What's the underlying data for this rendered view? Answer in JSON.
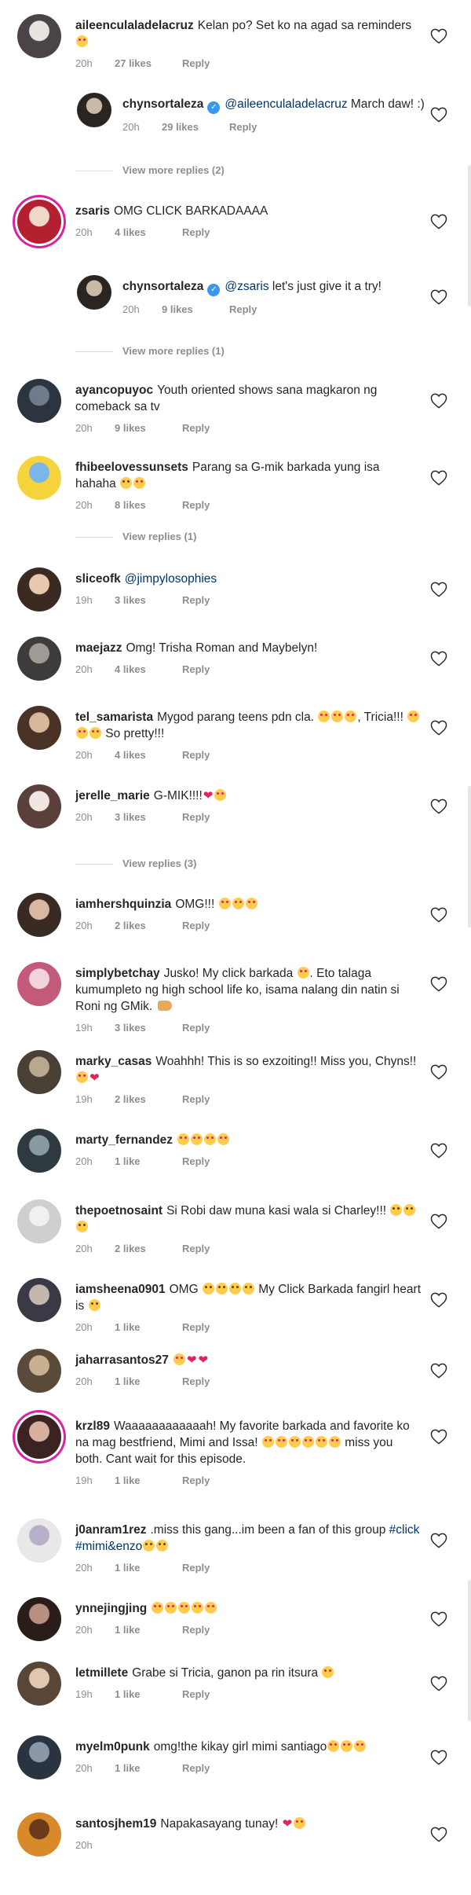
{
  "comments": [
    {
      "username": "aileenculaladelacruz",
      "segments": [
        {
          "t": "text",
          "v": "Kelan po? Set ko na agad sa reminders "
        },
        {
          "t": "emoji",
          "v": "heart-eyes"
        }
      ],
      "time": "20h",
      "likes": "27 likes",
      "reply_label": "Reply",
      "avatar_colors": [
        "#4a4448",
        "#e8e2e0"
      ],
      "ring": false
    },
    {
      "username": "chynsortaleza",
      "verified": true,
      "reply": true,
      "segments": [
        {
          "t": "mention",
          "v": "@aileenculaladelacruz"
        },
        {
          "t": "text",
          "v": " March daw! :)"
        }
      ],
      "time": "20h",
      "likes": "29 likes",
      "reply_label": "Reply",
      "avatar_colors": [
        "#2b2521",
        "#c9b9a6"
      ],
      "ring": false
    },
    {
      "view_replies": "View more replies (2)"
    },
    {
      "username": "zsaris",
      "segments": [
        {
          "t": "text",
          "v": "OMG CLICK BARKADAAAA"
        }
      ],
      "time": "20h",
      "likes": "4 likes",
      "reply_label": "Reply",
      "avatar_colors": [
        "#b3202f",
        "#f0d8c8"
      ],
      "ring": true
    },
    {
      "username": "chynsortaleza",
      "verified": true,
      "reply": true,
      "segments": [
        {
          "t": "mention",
          "v": "@zsaris"
        },
        {
          "t": "text",
          "v": " let's just give it a try!"
        }
      ],
      "time": "20h",
      "likes": "9 likes",
      "reply_label": "Reply",
      "avatar_colors": [
        "#2b2521",
        "#c9b9a6"
      ],
      "ring": false
    },
    {
      "view_replies": "View more replies (1)"
    },
    {
      "username": "ayancopuyoc",
      "segments": [
        {
          "t": "text",
          "v": "Youth oriented shows sana magkaron ng comeback sa tv"
        }
      ],
      "time": "20h",
      "likes": "9 likes",
      "reply_label": "Reply",
      "avatar_colors": [
        "#2c3440",
        "#6f7a8a"
      ],
      "ring": false
    },
    {
      "username": "fhibeelovessunsets",
      "segments": [
        {
          "t": "text",
          "v": "Parang sa G-mik barkada yung isa hahaha "
        },
        {
          "t": "emoji",
          "v": "blush"
        },
        {
          "t": "emoji",
          "v": "heart-eyes"
        }
      ],
      "time": "20h",
      "likes": "8 likes",
      "reply_label": "Reply",
      "avatar_colors": [
        "#f5d33a",
        "#7ab6e8"
      ],
      "ring": false
    },
    {
      "view_replies": "View replies (1)"
    },
    {
      "username": "sliceofk",
      "segments": [
        {
          "t": "mention",
          "v": "@jimpylosophies"
        }
      ],
      "time": "19h",
      "likes": "3 likes",
      "reply_label": "Reply",
      "avatar_colors": [
        "#3b2a22",
        "#e8c9b0"
      ],
      "ring": false
    },
    {
      "username": "maejazz",
      "segments": [
        {
          "t": "text",
          "v": "Omg! Trisha Roman and Maybelyn!"
        }
      ],
      "time": "20h",
      "likes": "4 likes",
      "reply_label": "Reply",
      "avatar_colors": [
        "#3c3c3c",
        "#a09a96"
      ],
      "ring": false
    },
    {
      "username": "tel_samarista",
      "segments": [
        {
          "t": "text",
          "v": "Mygod parang teens pdn cla. "
        },
        {
          "t": "emoji",
          "v": "heart-eyes"
        },
        {
          "t": "emoji",
          "v": "heart-eyes"
        },
        {
          "t": "emoji",
          "v": "heart-eyes"
        },
        {
          "t": "text",
          "v": ", Tricia!!! "
        },
        {
          "t": "emoji",
          "v": "heart-eyes"
        },
        {
          "t": "emoji",
          "v": "heart-eyes"
        },
        {
          "t": "emoji",
          "v": "heart-eyes"
        },
        {
          "t": "text",
          "v": " So pretty!!!"
        }
      ],
      "time": "20h",
      "likes": "4 likes",
      "reply_label": "Reply",
      "avatar_colors": [
        "#4a3326",
        "#d9b79a"
      ],
      "ring": false
    },
    {
      "username": "jerelle_marie",
      "segments": [
        {
          "t": "text",
          "v": "G-MIK!!!!"
        },
        {
          "t": "heart",
          "v": "red-heart"
        },
        {
          "t": "emoji",
          "v": "heart-eyes"
        }
      ],
      "time": "20h",
      "likes": "3 likes",
      "reply_label": "Reply",
      "avatar_colors": [
        "#5a3f3a",
        "#f2e6e2"
      ],
      "ring": false
    },
    {
      "view_replies": "View replies (3)"
    },
    {
      "username": "iamhershquinzia",
      "segments": [
        {
          "t": "text",
          "v": "OMG!!! "
        },
        {
          "t": "emoji",
          "v": "heart-eyes"
        },
        {
          "t": "emoji",
          "v": "heart-eyes"
        },
        {
          "t": "emoji",
          "v": "heart-eyes"
        }
      ],
      "time": "20h",
      "likes": "2 likes",
      "reply_label": "Reply",
      "avatar_colors": [
        "#3a2a24",
        "#d8b8a0"
      ],
      "ring": false
    },
    {
      "username": "simplybetchay",
      "segments": [
        {
          "t": "text",
          "v": "Jusko! My click barkada "
        },
        {
          "t": "emoji",
          "v": "heart-eyes"
        },
        {
          "t": "text",
          "v": ". Eto talaga kumumpleto ng high school life ko, isama nalang din natin si Roni ng GMik. "
        },
        {
          "t": "hand",
          "v": "point-hand"
        }
      ],
      "time": "19h",
      "likes": "3 likes",
      "reply_label": "Reply",
      "avatar_colors": [
        "#c45a7a",
        "#f3d4de"
      ],
      "ring": false
    },
    {
      "username": "marky_casas",
      "segments": [
        {
          "t": "text",
          "v": "Woahhh! This is so exzoiting!! Miss you, Chyns!! "
        },
        {
          "t": "emoji",
          "v": "wink"
        },
        {
          "t": "heart",
          "v": "red-heart"
        }
      ],
      "time": "19h",
      "likes": "2 likes",
      "reply_label": "Reply",
      "avatar_colors": [
        "#4a4036",
        "#b8a890"
      ],
      "ring": false
    },
    {
      "username": "marty_fernandez",
      "segments": [
        {
          "t": "emoji",
          "v": "heart-eyes"
        },
        {
          "t": "emoji",
          "v": "heart-eyes"
        },
        {
          "t": "emoji",
          "v": "heart-eyes"
        },
        {
          "t": "emoji",
          "v": "heart-eyes"
        }
      ],
      "time": "20h",
      "likes": "1 like",
      "reply_label": "Reply",
      "avatar_colors": [
        "#2e3a40",
        "#8a9aa2"
      ],
      "ring": false
    },
    {
      "username": "thepoetnosaint",
      "segments": [
        {
          "t": "text",
          "v": "Si Robi daw muna kasi wala si Charley!!! "
        },
        {
          "t": "emoji",
          "v": "laugh"
        },
        {
          "t": "emoji",
          "v": "blush"
        },
        {
          "t": "emoji",
          "v": "laugh"
        }
      ],
      "time": "20h",
      "likes": "2 likes",
      "reply_label": "Reply",
      "avatar_colors": [
        "#cfcfcf",
        "#f0f0f0"
      ],
      "ring": false
    },
    {
      "username": "iamsheena0901",
      "segments": [
        {
          "t": "text",
          "v": "OMG "
        },
        {
          "t": "emoji",
          "v": "laugh"
        },
        {
          "t": "emoji",
          "v": "laugh"
        },
        {
          "t": "emoji",
          "v": "laugh"
        },
        {
          "t": "emoji",
          "v": "laugh"
        },
        {
          "t": "text",
          "v": " My Click Barkada fangirl heart is "
        },
        {
          "t": "emoji",
          "v": "laugh"
        }
      ],
      "time": "20h",
      "likes": "1 like",
      "reply_label": "Reply",
      "avatar_colors": [
        "#3a3a46",
        "#c4b8ae"
      ],
      "ring": false
    },
    {
      "username": "jaharrasantos27",
      "segments": [
        {
          "t": "emoji",
          "v": "scream"
        },
        {
          "t": "heart",
          "v": "red-heart"
        },
        {
          "t": "heart",
          "v": "red-heart"
        }
      ],
      "time": "20h",
      "likes": "1 like",
      "reply_label": "Reply",
      "avatar_colors": [
        "#5a4a3a",
        "#c8b090"
      ],
      "ring": false
    },
    {
      "username": "krzl89",
      "segments": [
        {
          "t": "text",
          "v": "Waaaaaaaaaaaah! My favorite barkada and favorite ko na mag bestfriend, Mimi and Issa! "
        },
        {
          "t": "emoji",
          "v": "heart-eyes"
        },
        {
          "t": "emoji",
          "v": "heart-eyes"
        },
        {
          "t": "emoji",
          "v": "heart-eyes"
        },
        {
          "t": "emoji",
          "v": "heart-eyes"
        },
        {
          "t": "emoji",
          "v": "heart-eyes"
        },
        {
          "t": "emoji",
          "v": "heart-eyes"
        },
        {
          "t": "text",
          "v": " miss you both. Cant wait for this episode."
        }
      ],
      "time": "19h",
      "likes": "1 like",
      "reply_label": "Reply",
      "avatar_colors": [
        "#3a2320",
        "#d8b0a0"
      ],
      "ring": true
    },
    {
      "username": "j0anram1rez",
      "segments": [
        {
          "t": "text",
          "v": ".miss this gang...im been a fan of this group "
        },
        {
          "t": "hashtag",
          "v": "#click"
        },
        {
          "t": "text",
          "v": " "
        },
        {
          "t": "hashtag",
          "v": "#mimi&enzo"
        },
        {
          "t": "emoji",
          "v": "blush"
        },
        {
          "t": "emoji",
          "v": "blush"
        }
      ],
      "time": "20h",
      "likes": "1 like",
      "reply_label": "Reply",
      "avatar_colors": [
        "#e8e8e8",
        "#b8b0c8"
      ],
      "ring": false
    },
    {
      "username": "ynnejingjing",
      "segments": [
        {
          "t": "emoji",
          "v": "heart-eyes"
        },
        {
          "t": "emoji",
          "v": "heart-eyes"
        },
        {
          "t": "emoji",
          "v": "heart-eyes"
        },
        {
          "t": "emoji",
          "v": "heart-eyes"
        },
        {
          "t": "emoji",
          "v": "heart-eyes"
        }
      ],
      "time": "20h",
      "likes": "1 like",
      "reply_label": "Reply",
      "avatar_colors": [
        "#2a1c18",
        "#b89080"
      ],
      "ring": false
    },
    {
      "username": "letmillete",
      "segments": [
        {
          "t": "text",
          "v": "Grabe si Tricia, ganon pa rin itsura "
        },
        {
          "t": "emoji",
          "v": "heart-eyes"
        }
      ],
      "time": "19h",
      "likes": "1 like",
      "reply_label": "Reply",
      "avatar_colors": [
        "#5a4636",
        "#e0c8b0"
      ],
      "ring": false
    },
    {
      "username": "myelm0punk",
      "segments": [
        {
          "t": "text",
          "v": "omg!the kikay girl mimi santiago"
        },
        {
          "t": "emoji",
          "v": "heart-eyes"
        },
        {
          "t": "emoji",
          "v": "heart-eyes"
        },
        {
          "t": "emoji",
          "v": "heart-eyes"
        }
      ],
      "time": "20h",
      "likes": "1 like",
      "reply_label": "Reply",
      "avatar_colors": [
        "#2a3440",
        "#8a98a8"
      ],
      "ring": false
    },
    {
      "username": "santosjhem19",
      "segments": [
        {
          "t": "text",
          "v": "Napakasayang tunay! "
        },
        {
          "t": "heart",
          "v": "red-heart"
        },
        {
          "t": "emoji",
          "v": "heart-eyes"
        }
      ],
      "time": "20h",
      "likes": "",
      "reply_label": "",
      "avatar_colors": [
        "#d88a2a",
        "#6a3a1a"
      ],
      "ring": false
    }
  ]
}
